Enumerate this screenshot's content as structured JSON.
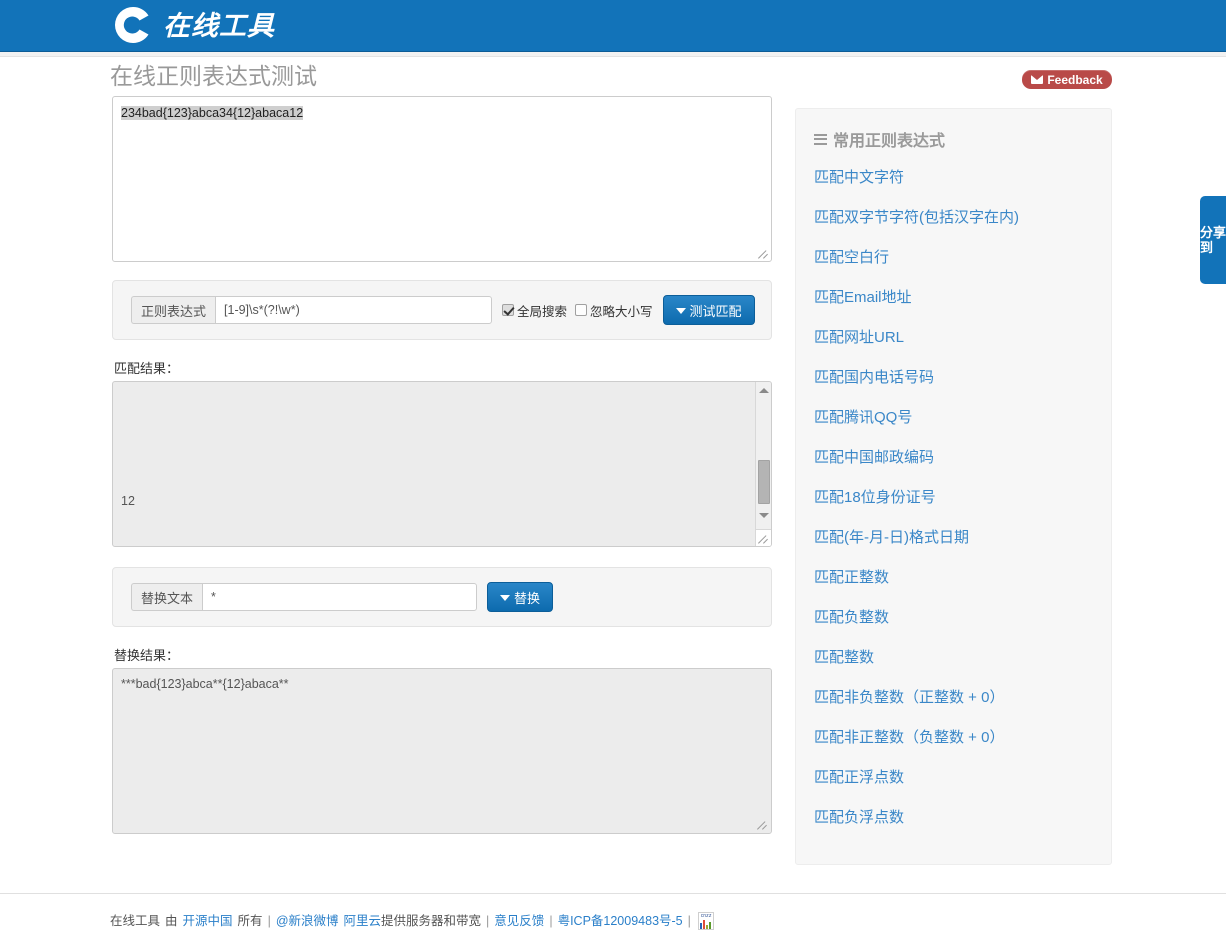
{
  "site": {
    "brand": "在线工具",
    "logo_icon": "logo-c-icon"
  },
  "header": {
    "page_title": "在线正则表达式测试",
    "feedback_label": "Feedback",
    "feedback_icon": "envelope-icon"
  },
  "share": {
    "label": "分享到"
  },
  "editor": {
    "source_text": "234bad{123}abca34{12}abaca12"
  },
  "regex_form": {
    "label": "正则表达式",
    "value": "[1-9]\\s*(?!\\w*)",
    "global_search_label": "全局搜索",
    "global_search_checked": true,
    "ignore_case_label": "忽略大小写",
    "ignore_case_checked": false,
    "test_button_label": "测试匹配",
    "test_button_icon": "chevron-down-icon"
  },
  "match_result": {
    "label": "匹配结果：",
    "value": "12"
  },
  "replace_form": {
    "label": "替换文本",
    "value": "*",
    "button_label": "替换",
    "button_icon": "chevron-down-icon"
  },
  "replace_result": {
    "label": "替换结果：",
    "value": "***bad{123}abca**{12}abaca**"
  },
  "sidebar": {
    "title": "常用正则表达式",
    "title_icon": "list-icon",
    "items": [
      "匹配中文字符",
      "匹配双字节字符(包括汉字在内)",
      "匹配空白行",
      "匹配Email地址",
      "匹配网址URL",
      "匹配国内电话号码",
      "匹配腾讯QQ号",
      "匹配中国邮政编码",
      "匹配18位身份证号",
      "匹配(年-月-日)格式日期",
      "匹配正整数",
      "匹配负整数",
      "匹配整数",
      "匹配非负整数（正整数 + 0）",
      "匹配非正整数（负整数 + 0）",
      "匹配正浮点数",
      "匹配负浮点数"
    ]
  },
  "footer": {
    "site_name": "在线工具",
    "by": "由",
    "owner": "开源中国",
    "owned": "所有",
    "sep": "|",
    "weibo": "@新浪微博",
    "aliyun": "阿里云",
    "aliyun_suffix": "提供服务器和带宽",
    "feedback": "意见反馈",
    "icp": "粤ICP备12009483号-5",
    "stats_icon": "cnzz-stats-icon"
  },
  "colors": {
    "brand_blue": "#1273b9",
    "link_blue": "#3a87c8",
    "feedback_red": "#b94a48"
  }
}
